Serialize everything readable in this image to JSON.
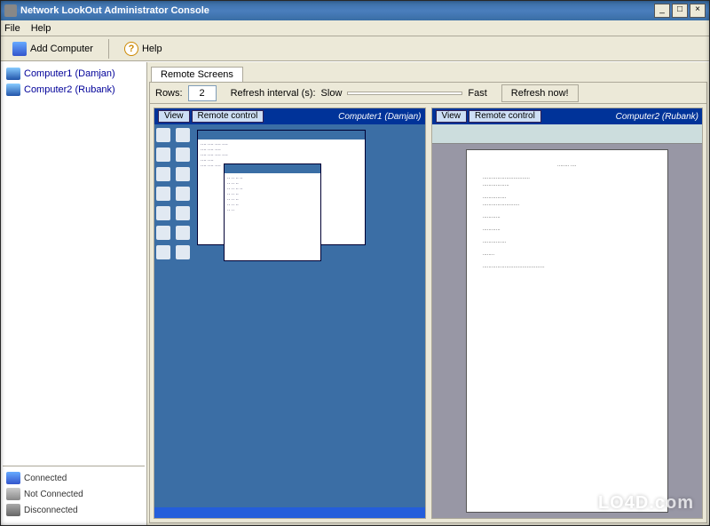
{
  "window": {
    "title": "Network LookOut Administrator Console",
    "min": "_",
    "max": "□",
    "close": "×"
  },
  "menu": {
    "file": "File",
    "help": "Help"
  },
  "toolbar": {
    "add_computer": "Add Computer",
    "help": "Help"
  },
  "sidebar": {
    "computers": [
      {
        "label": "Computer1 (Damjan)"
      },
      {
        "label": "Computer2 (Rubank)"
      }
    ],
    "legend": {
      "connected": "Connected",
      "not_connected": "Not Connected",
      "disconnected": "Disconnected"
    }
  },
  "tab": {
    "screens": "Remote Screens"
  },
  "controlbar": {
    "rows_label": "Rows:",
    "rows_value": "2",
    "refresh_label": "Refresh interval (s):",
    "slow": "Slow",
    "fast": "Fast",
    "refresh_btn": "Refresh now!"
  },
  "cards": {
    "view_btn": "View",
    "remote_btn": "Remote control",
    "c1_title": "Computer1 (Damjan)",
    "c2_title": "Computer2 (Rubank)"
  },
  "watermark": "LO4D.com"
}
